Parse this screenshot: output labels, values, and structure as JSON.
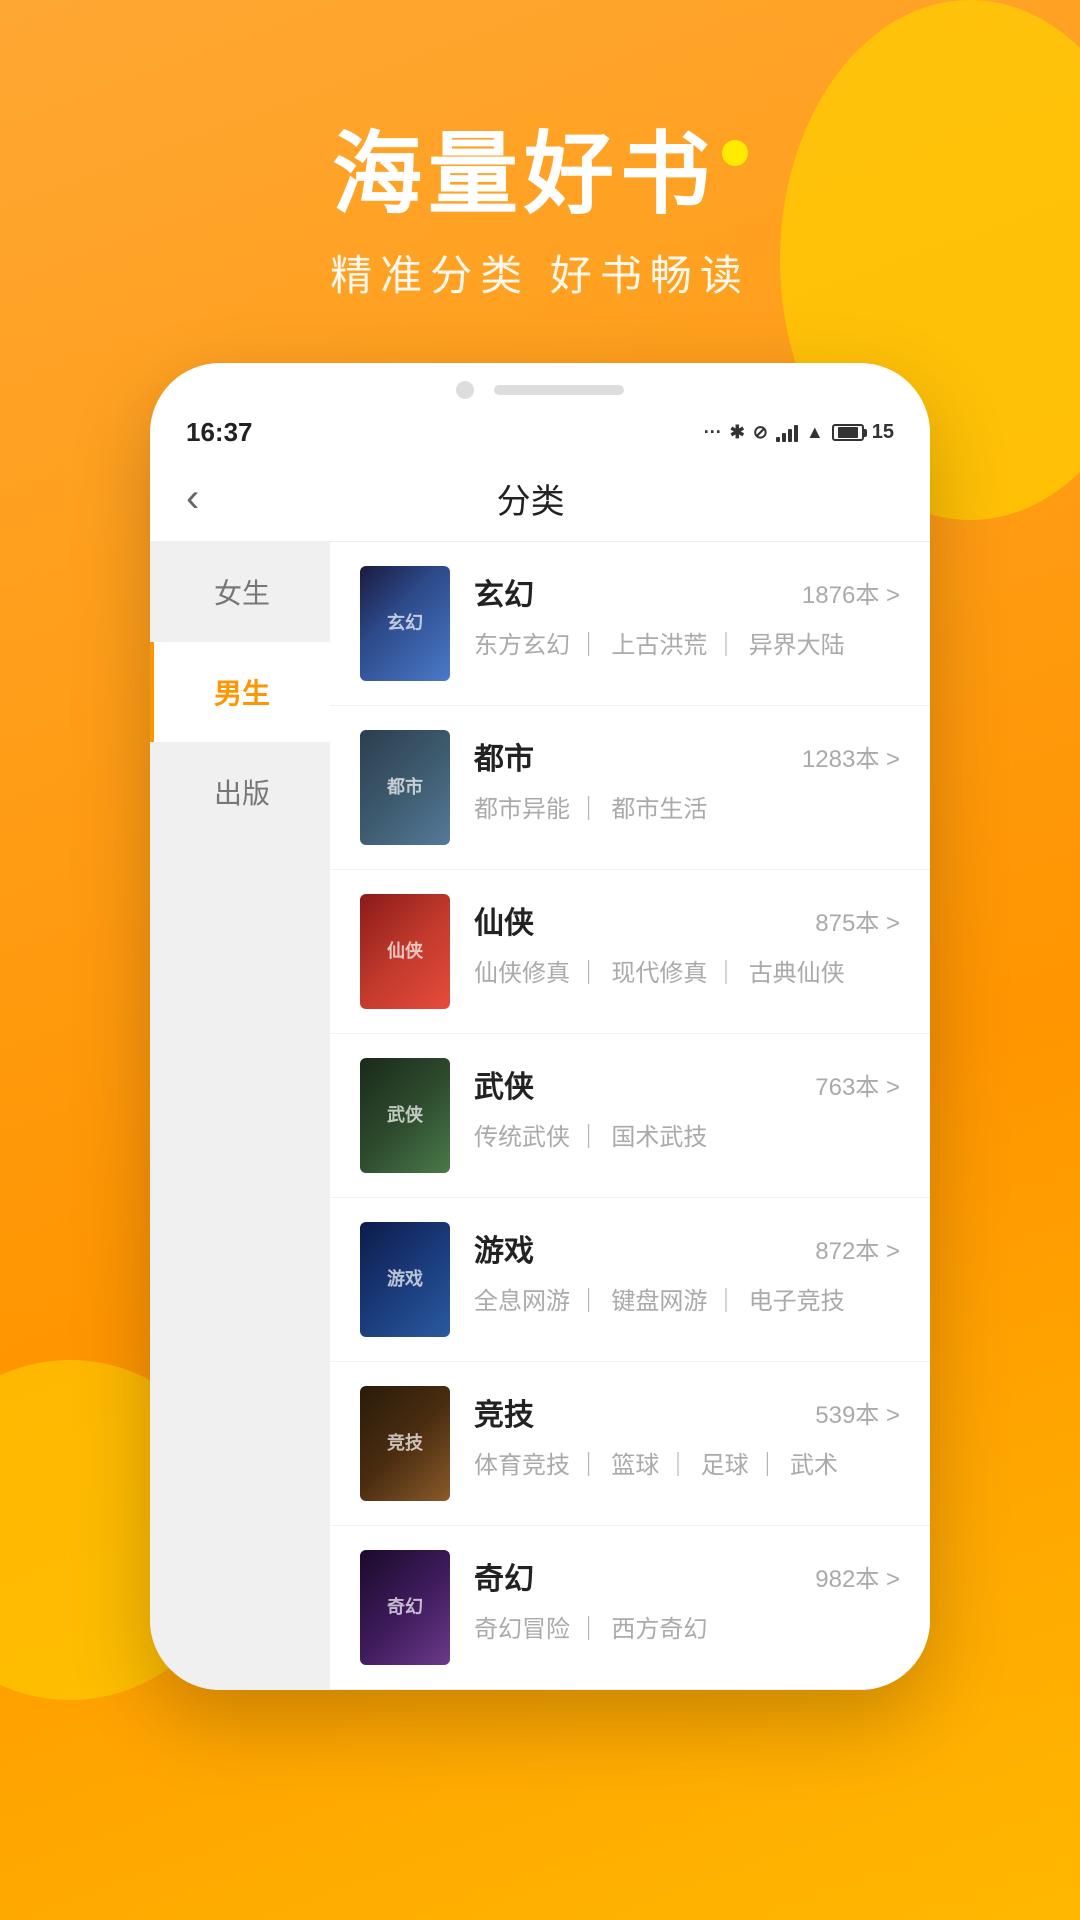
{
  "app": {
    "background_color": "#FF9500",
    "accent_color": "#FF9500",
    "hero": {
      "title": "海量好书",
      "subtitle": "精准分类 好书畅读",
      "dot_color": "#FFEB00"
    }
  },
  "phone": {
    "status_bar": {
      "time": "16:37",
      "battery_label": "15"
    },
    "nav": {
      "back_label": "‹",
      "title": "分类"
    },
    "sidebar": {
      "items": [
        {
          "id": "female",
          "label": "女生",
          "active": false
        },
        {
          "id": "male",
          "label": "男生",
          "active": true
        },
        {
          "id": "publish",
          "label": "出版",
          "active": false
        }
      ]
    },
    "categories": [
      {
        "id": "cat-1",
        "name": "玄幻",
        "count": "1876本 >",
        "tags": [
          "东方玄幻",
          "上古洪荒",
          "异界大陆"
        ],
        "cover_class": "cover-1",
        "cover_text": "玄幻"
      },
      {
        "id": "cat-2",
        "name": "都市",
        "count": "1283本 >",
        "tags": [
          "都市异能",
          "都市生活"
        ],
        "cover_class": "cover-2",
        "cover_text": "都市"
      },
      {
        "id": "cat-3",
        "name": "仙侠",
        "count": "875本 >",
        "tags": [
          "仙侠修真",
          "现代修真",
          "古典仙侠"
        ],
        "cover_class": "cover-3",
        "cover_text": "仙侠"
      },
      {
        "id": "cat-4",
        "name": "武侠",
        "count": "763本 >",
        "tags": [
          "传统武侠",
          "国术武技"
        ],
        "cover_class": "cover-4",
        "cover_text": "武侠"
      },
      {
        "id": "cat-5",
        "name": "游戏",
        "count": "872本 >",
        "tags": [
          "全息网游",
          "键盘网游",
          "电子竞技"
        ],
        "cover_class": "cover-5",
        "cover_text": "游戏"
      },
      {
        "id": "cat-6",
        "name": "竞技",
        "count": "539本 >",
        "tags": [
          "体育竞技",
          "篮球",
          "足球",
          "武术"
        ],
        "cover_class": "cover-6",
        "cover_text": "竞技"
      },
      {
        "id": "cat-7",
        "name": "奇幻",
        "count": "982本 >",
        "tags": [
          "奇幻冒险",
          "西方奇幻"
        ],
        "cover_class": "cover-7",
        "cover_text": "奇幻"
      }
    ]
  }
}
